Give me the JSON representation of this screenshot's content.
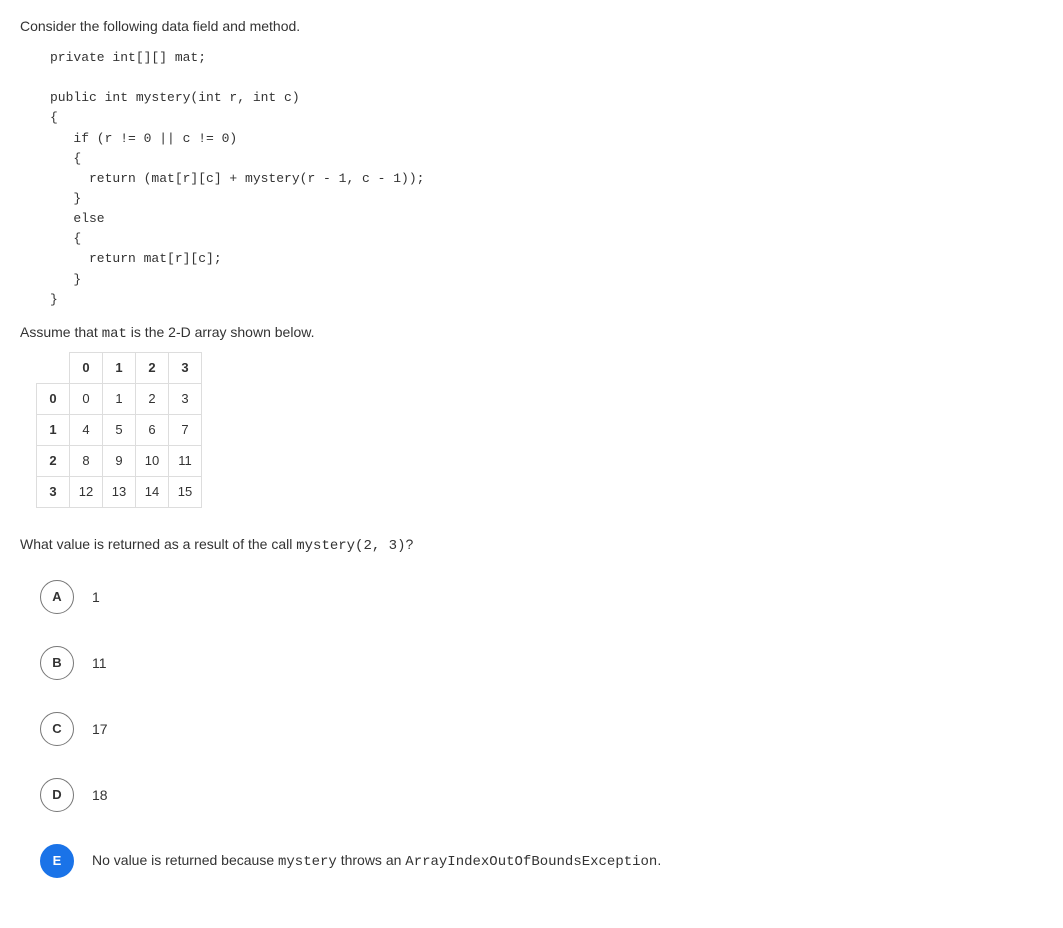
{
  "intro": "Consider the following data field and method.",
  "code": "private int[][] mat;\n\npublic int mystery(int r, int c)\n{\n   if (r != 0 || c != 0)\n   {\n     return (mat[r][c] + mystery(r - 1, c - 1));\n   }\n   else\n   {\n     return mat[r][c];\n   }\n}",
  "assume_pre": "Assume that ",
  "assume_code": "mat",
  "assume_post": "  is the 2-D array shown below.",
  "table": {
    "col_headers": [
      "0",
      "1",
      "2",
      "3"
    ],
    "row_headers": [
      "0",
      "1",
      "2",
      "3"
    ],
    "cells": [
      [
        "0",
        "1",
        "2",
        "3"
      ],
      [
        "4",
        "5",
        "6",
        "7"
      ],
      [
        "8",
        "9",
        "10",
        "11"
      ],
      [
        "12",
        "13",
        "14",
        "15"
      ]
    ]
  },
  "prompt_pre": "What value is returned as a result of the call ",
  "prompt_code": "mystery(2, 3)",
  "prompt_post": "?",
  "choices": [
    {
      "letter": "A",
      "text": "1",
      "selected": false
    },
    {
      "letter": "B",
      "text": "11",
      "selected": false
    },
    {
      "letter": "C",
      "text": "17",
      "selected": false
    },
    {
      "letter": "D",
      "text": "18",
      "selected": false
    }
  ],
  "choice_e": {
    "letter": "E",
    "pre": "No value is returned because ",
    "code1": "mystery",
    "mid": " throws an ",
    "code2": "ArrayIndexOutOfBoundsException",
    "post": ".",
    "selected": true
  }
}
